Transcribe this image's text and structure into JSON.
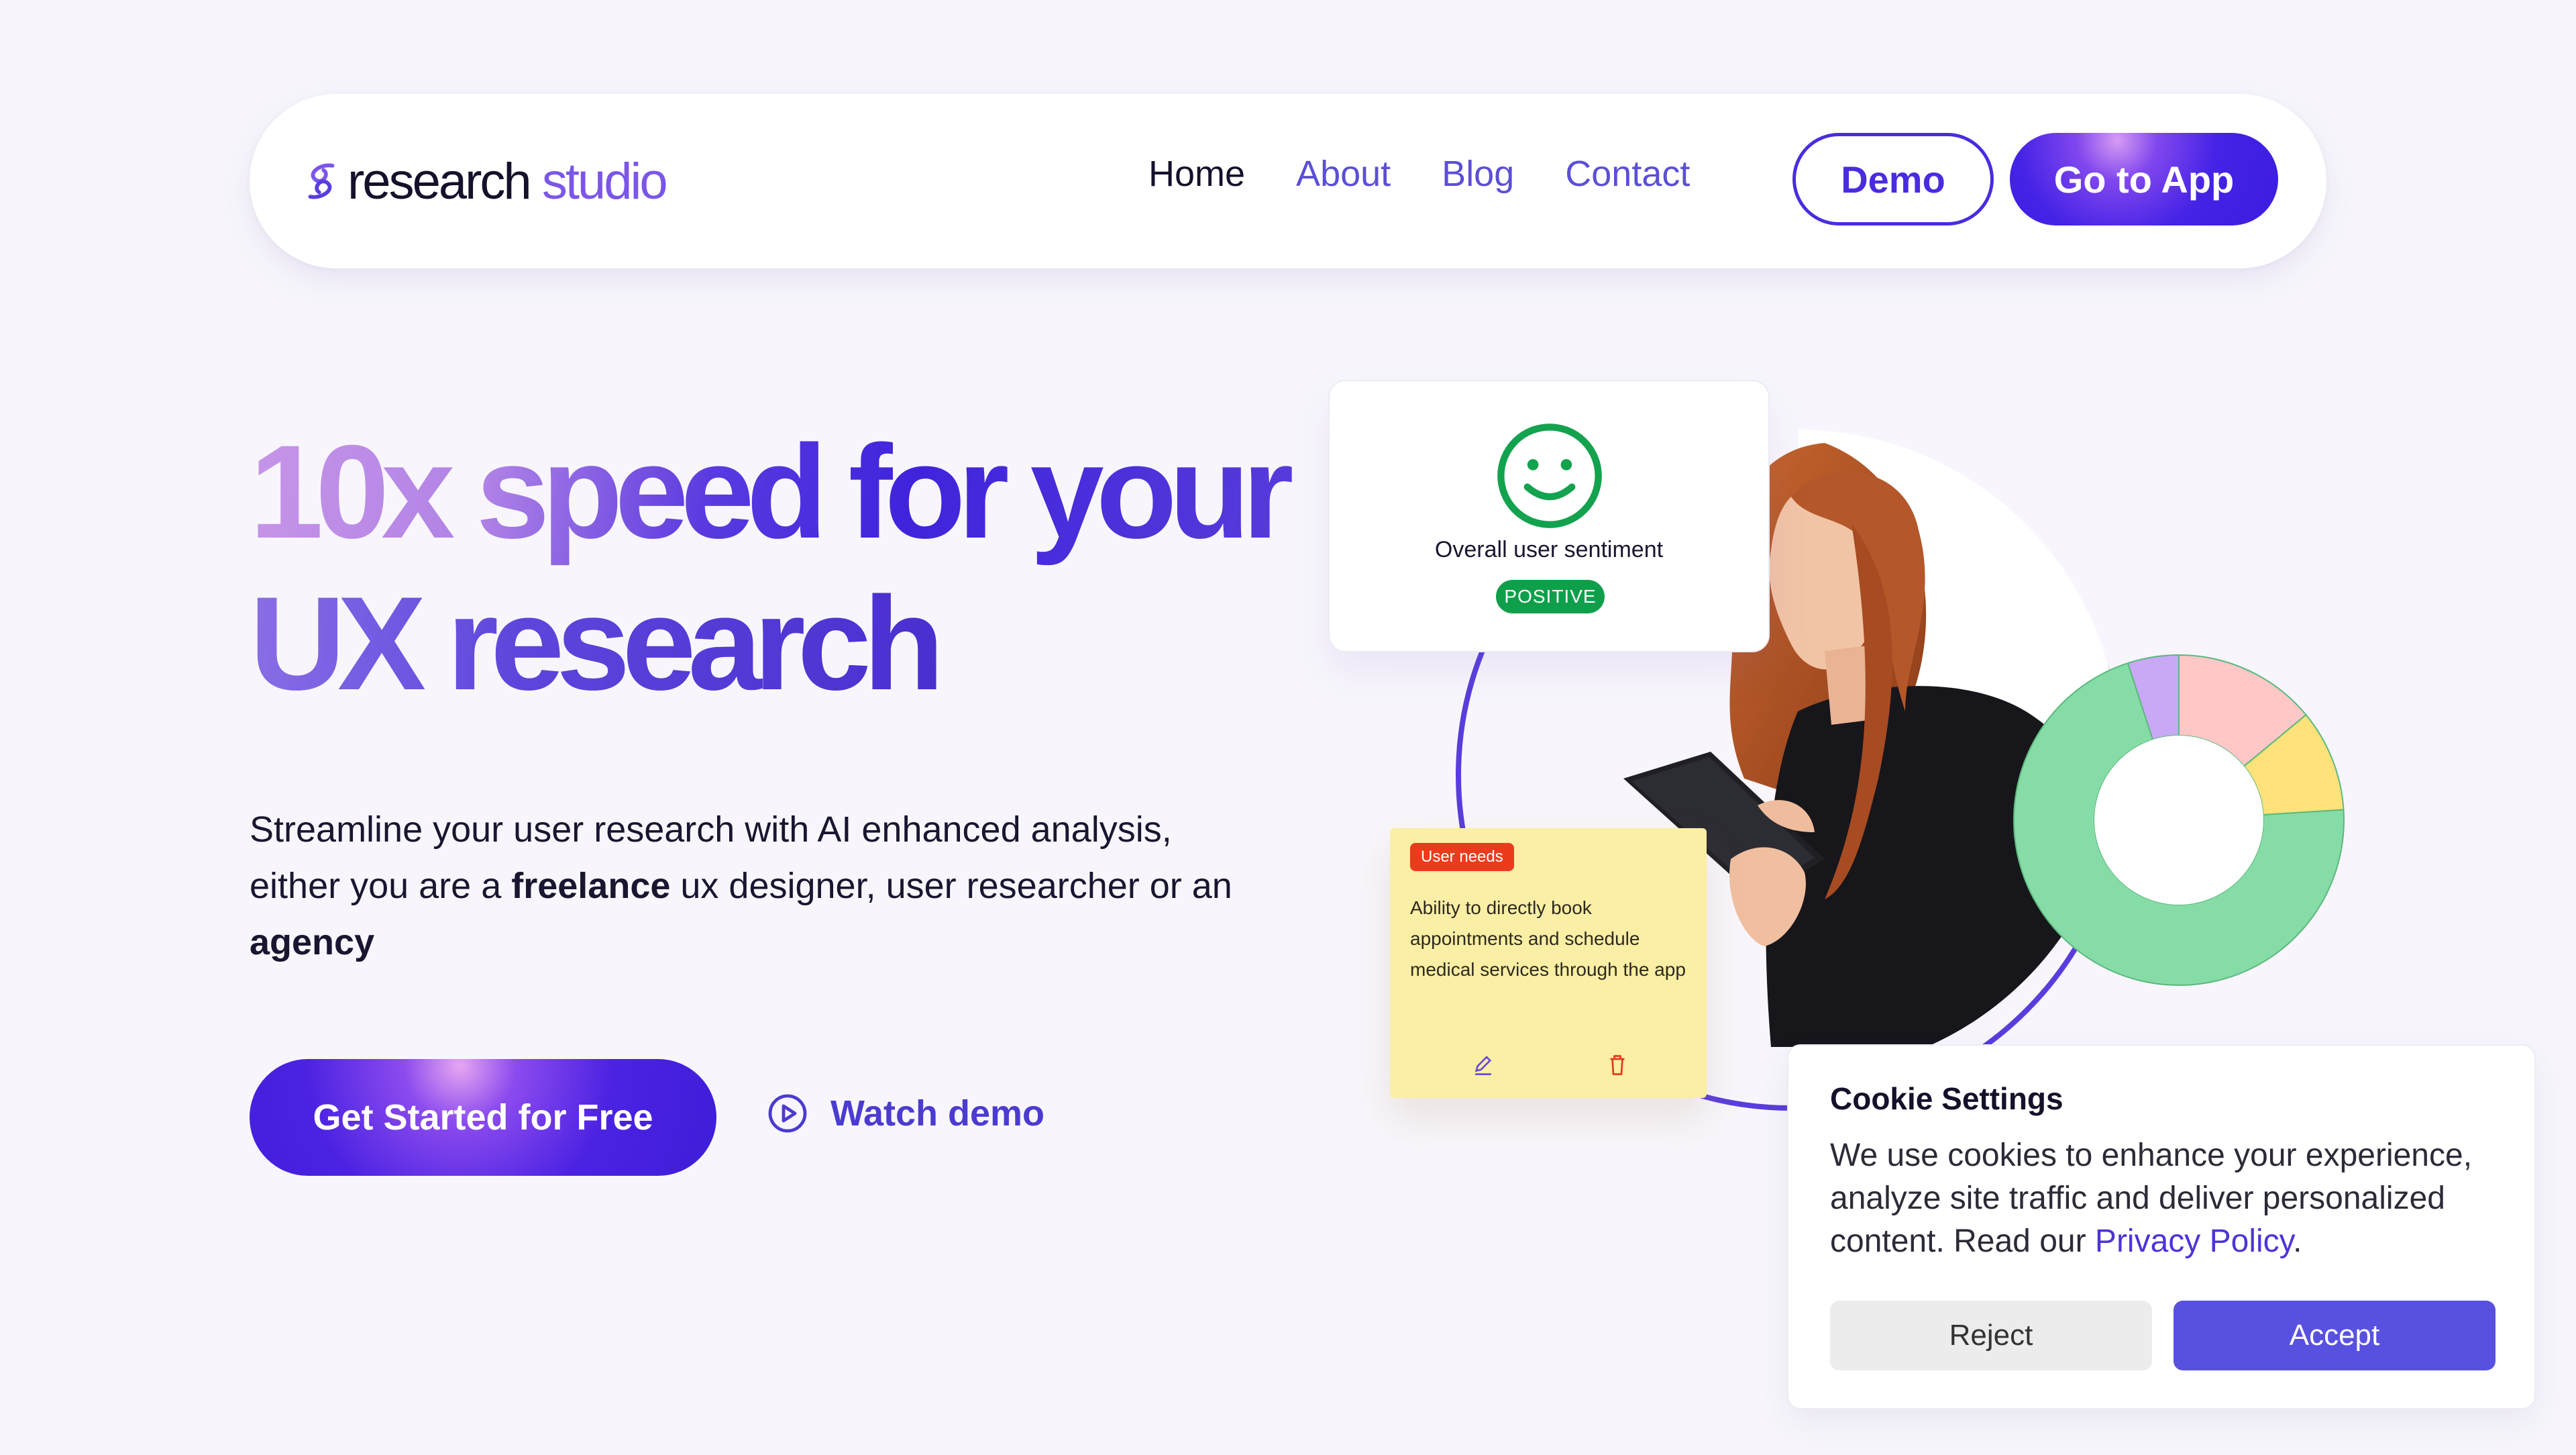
{
  "nav": {
    "logo_part1": "research",
    "logo_part2": "studio",
    "links": [
      {
        "label": "Home"
      },
      {
        "label": "About"
      },
      {
        "label": "Blog"
      },
      {
        "label": "Contact"
      }
    ],
    "demo_label": "Demo",
    "app_label": "Go to App"
  },
  "hero": {
    "title_line1_a": "10x speed",
    "title_line1_b": "for your",
    "title_line2": "UX research",
    "sub_1": "Streamline your user research with AI enhanced analysis, either you are a ",
    "sub_bold1": "freelance",
    "sub_2": " ux designer, user researcher or an ",
    "sub_bold2": "agency",
    "cta_label": "Get Started for Free",
    "watch_label": "Watch demo"
  },
  "sentiment_card": {
    "label": "Overall user sentiment",
    "badge": "POSITIVE"
  },
  "note": {
    "tag": "User needs",
    "text": "Ability to directly book appointments and schedule medical services through the app"
  },
  "donut": {
    "segments": [
      {
        "name": "pink",
        "value": 0.14,
        "color": "#ffc7c7"
      },
      {
        "name": "yellow",
        "value": 0.1,
        "color": "#ffe27a"
      },
      {
        "name": "green",
        "value": 0.71,
        "color": "#86dca6"
      },
      {
        "name": "purple",
        "value": 0.05,
        "color": "#c9a8f5"
      }
    ]
  },
  "cookie": {
    "title": "Cookie Settings",
    "text_1": "We use cookies to enhance your experience, analyze site traffic and deliver personalized content. Read our ",
    "link": "Privacy Policy",
    "text_2": ".",
    "reject_label": "Reject",
    "accept_label": "Accept"
  }
}
